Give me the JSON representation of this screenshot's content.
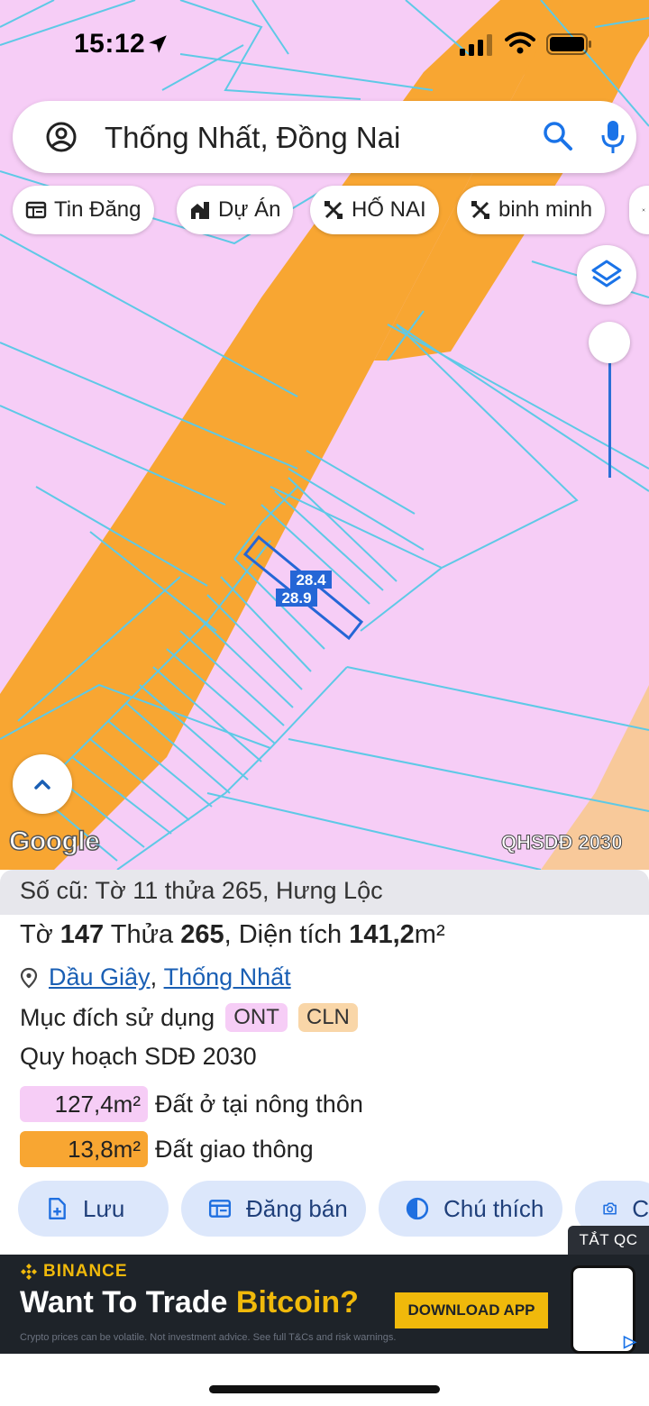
{
  "status_bar": {
    "time": "15:12"
  },
  "search": {
    "query": "Thống Nhất, Đồng Nai"
  },
  "chips": [
    {
      "label": "Tin Đăng",
      "icon": "listing-icon"
    },
    {
      "label": "Dự Án",
      "icon": "project-icon"
    },
    {
      "label": "HỐ NAI",
      "icon": "shape-icon"
    },
    {
      "label": "binh minh",
      "icon": "shape-icon"
    }
  ],
  "map": {
    "parcel_label_top": "28.4",
    "parcel_label_bottom": "28.9",
    "google_logo": "Google",
    "plan_tag": "QHSDĐ 2030",
    "colors": {
      "residential": "#f6cdf6",
      "transport": "#f8a632",
      "parcel_lines": "#5ec9e6",
      "selected_parcel": "#2566d6"
    }
  },
  "panel": {
    "old_ref": "Số cũ: Tờ 11 thửa 265, Hưng Lộc",
    "sheet_label": "Tờ",
    "sheet_number": "147",
    "parcel_label": "Thửa",
    "parcel_number": "265",
    "area_label": "Diện tích",
    "area_value": "141,2",
    "area_unit": "m²",
    "district": "Dầu Giây",
    "commune": "Thống Nhất",
    "purpose_label": "Mục đích sử dụng",
    "badges": [
      {
        "text": "ONT",
        "color": "#f6cdf6"
      },
      {
        "text": "CLN",
        "color": "#f9d6a8"
      }
    ],
    "plan_label": "Quy hoạch SDĐ 2030",
    "areas": [
      {
        "value": "127,4m²",
        "desc": "Đất ở tại nông thôn",
        "color": "#f6cdf6"
      },
      {
        "value": "13,8m²",
        "desc": "Đất giao thông",
        "color": "#f8a632"
      }
    ],
    "actions": [
      {
        "label": "Lưu",
        "icon": "save-doc-icon"
      },
      {
        "label": "Đăng bán",
        "icon": "listing-icon"
      },
      {
        "label": "Chú thích",
        "icon": "contrast-icon"
      },
      {
        "label": "C",
        "icon": "camera-icon"
      }
    ]
  },
  "ad": {
    "close_label": "TẮT QC",
    "brand": "BINANCE",
    "headline_part1": "Want To Trade ",
    "headline_part2": "Bitcoin?",
    "cta": "DOWNLOAD APP",
    "disclaimer": "Crypto prices can be volatile. Not investment advice. See full T&Cs and risk warnings.",
    "colors": {
      "brand": "#f0b90b",
      "background": "#1e2329"
    }
  }
}
